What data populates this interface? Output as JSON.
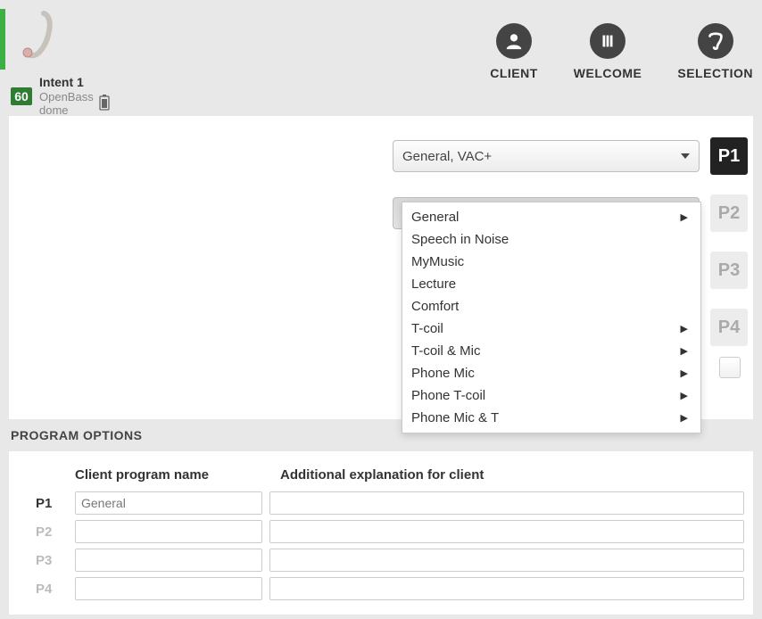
{
  "device": {
    "badge": "60",
    "name": "Intent 1",
    "sub": "OpenBass dome"
  },
  "nav": {
    "client": "CLIENT",
    "welcome": "WELCOME",
    "selection": "SELECTION"
  },
  "programs": {
    "p1": {
      "selected": "General, VAC+",
      "badge": "P1"
    },
    "p2": {
      "selected": "",
      "badge": "P2"
    },
    "p3": {
      "selected": "",
      "badge": "P3"
    },
    "p4": {
      "selected": "",
      "badge": "P4"
    }
  },
  "dropdown": {
    "items": [
      {
        "label": "General",
        "submenu": true
      },
      {
        "label": "Speech in Noise",
        "submenu": false
      },
      {
        "label": "MyMusic",
        "submenu": false
      },
      {
        "label": "Lecture",
        "submenu": false
      },
      {
        "label": "Comfort",
        "submenu": false
      },
      {
        "label": "T-coil",
        "submenu": true
      },
      {
        "label": "T-coil & Mic",
        "submenu": true
      },
      {
        "label": "Phone Mic",
        "submenu": true
      },
      {
        "label": "Phone T-coil",
        "submenu": true
      },
      {
        "label": "Phone Mic & T",
        "submenu": true
      }
    ]
  },
  "section": {
    "heading": "PROGRAM OPTIONS",
    "col_name": "Client program name",
    "col_expl": "Additional explanation for client",
    "rows": {
      "p1": {
        "label": "P1",
        "name": "General",
        "expl": ""
      },
      "p2": {
        "label": "P2",
        "name": "",
        "expl": ""
      },
      "p3": {
        "label": "P3",
        "name": "",
        "expl": ""
      },
      "p4": {
        "label": "P4",
        "name": "",
        "expl": ""
      }
    }
  }
}
